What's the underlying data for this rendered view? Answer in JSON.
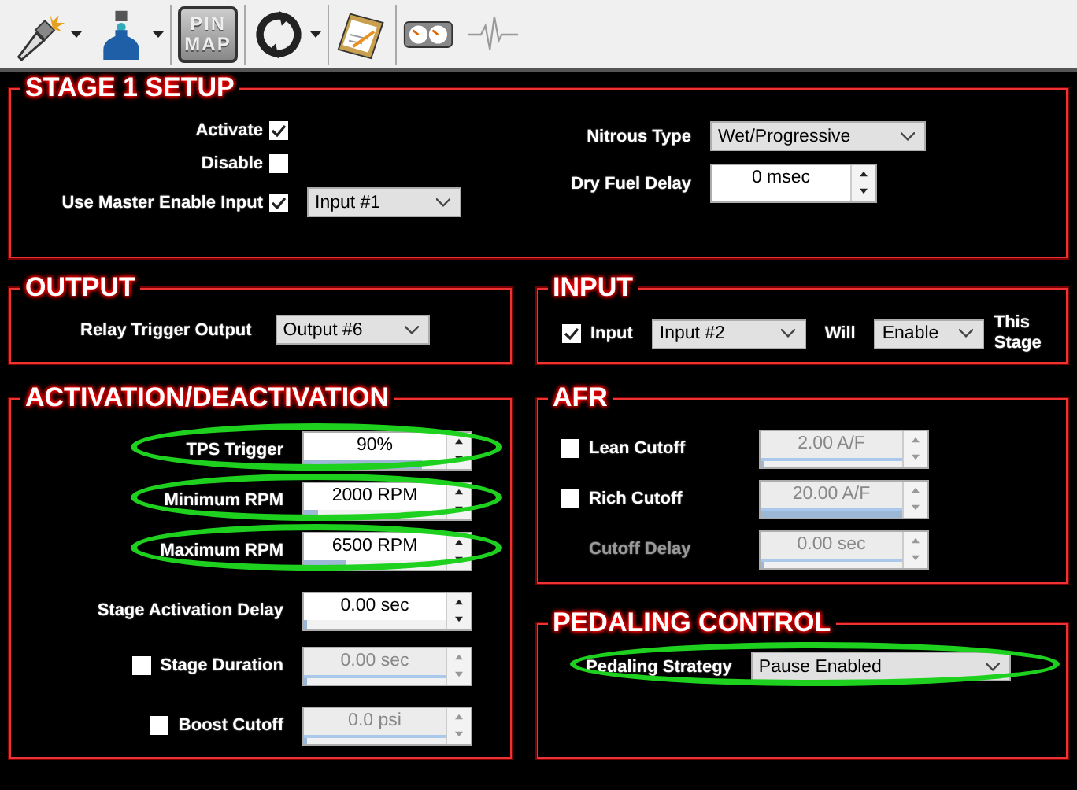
{
  "toolbar": {
    "groups": [
      [
        {
          "kind": "spark-plug",
          "menu": true
        },
        {
          "kind": "bottle",
          "menu": true
        }
      ],
      [
        {
          "kind": "pin-map",
          "label": "PIN MAP",
          "menu": false
        }
      ],
      [
        {
          "kind": "refresh",
          "menu": true
        }
      ],
      [
        {
          "kind": "clipboard",
          "menu": false
        }
      ],
      [
        {
          "kind": "gauges",
          "menu": false
        },
        {
          "kind": "heartbeat",
          "menu": false,
          "disabled": true
        }
      ]
    ]
  },
  "stage_setup": {
    "title": "STAGE 1 SETUP",
    "checks": [
      {
        "label": "Activate",
        "checked": true
      },
      {
        "label": "Disable",
        "checked": false
      },
      {
        "label": "Use Master Enable Input",
        "checked": true,
        "select": "Input #1"
      }
    ],
    "nitrous_type": {
      "label": "Nitrous Type",
      "value": "Wet/Progressive"
    },
    "dry_fuel_delay": {
      "label": "Dry Fuel Delay",
      "value": "0 msec"
    }
  },
  "output": {
    "title": "OUTPUT",
    "label": "Relay Trigger Output",
    "value": "Output #6"
  },
  "input": {
    "title": "INPUT",
    "checked": true,
    "label": "Input",
    "value": "Input #2",
    "will_label": "Will",
    "will_value": "Enable",
    "suffix": "This Stage"
  },
  "activation": {
    "title": "ACTIVATION/DEACTIVATION",
    "rows": [
      {
        "kind": "spin",
        "label": "TPS Trigger",
        "value": "90%",
        "level": 0.83,
        "disabled": false,
        "highlighted": true
      },
      {
        "kind": "spin",
        "label": "Minimum RPM",
        "value": "2000 RPM",
        "level": 0.1,
        "disabled": false,
        "highlighted": true
      },
      {
        "kind": "spin",
        "label": "Maximum RPM",
        "value": "6500 RPM",
        "level": 0.3,
        "disabled": false,
        "highlighted": true
      },
      {
        "kind": "spin",
        "label": "Stage Activation Delay",
        "value": "0.00 sec",
        "level": 0,
        "disabled": false,
        "highlighted": false
      },
      {
        "kind": "check-spin",
        "label": "Stage Duration",
        "checked": false,
        "value": "0.00 sec",
        "level": 0,
        "disabled": true,
        "highlighted": false
      },
      {
        "kind": "check-spin",
        "label": "Boost Cutoff",
        "checked": false,
        "value": "0.0 psi",
        "level": 0,
        "disabled": true,
        "highlighted": false
      }
    ]
  },
  "afr": {
    "title": "AFR",
    "rows": [
      {
        "kind": "check-spin",
        "label": "Lean Cutoff",
        "checked": false,
        "value": "2.00 A/F",
        "level": 0,
        "disabled": true
      },
      {
        "kind": "check-spin",
        "label": "Rich Cutoff",
        "checked": false,
        "value": "20.00 A/F",
        "level": 1,
        "disabled": true
      },
      {
        "kind": "spin",
        "label": "Cutoff Delay",
        "value": "0.00 sec",
        "level": 0,
        "disabled": true
      }
    ]
  },
  "pedaling": {
    "title": "PEDALING CONTROL",
    "label": "Pedaling Strategy",
    "value": "Pause Enabled",
    "highlighted": true
  }
}
